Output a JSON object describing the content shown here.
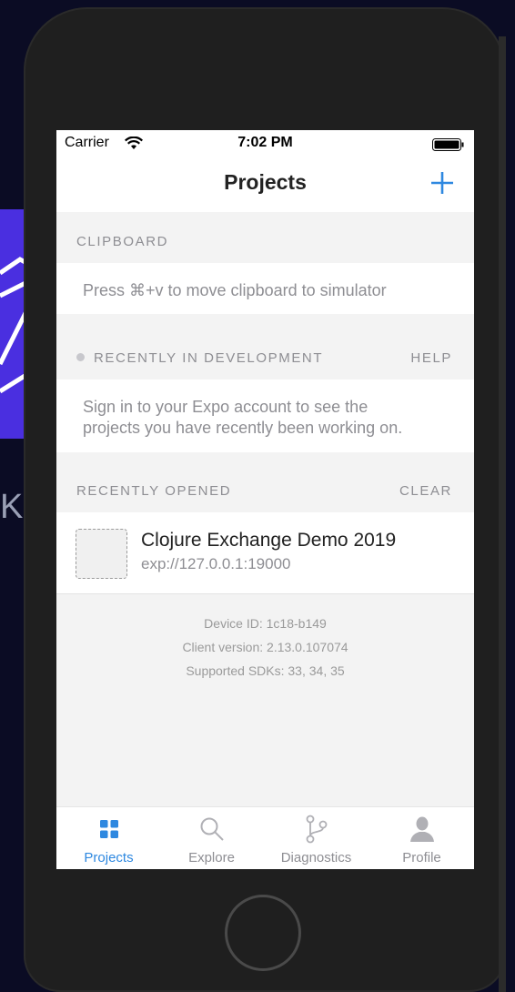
{
  "status_bar": {
    "carrier": "Carrier",
    "time": "7:02 PM"
  },
  "nav": {
    "title": "Projects"
  },
  "clipboard": {
    "header": "CLIPBOARD",
    "message": "Press ⌘+v to move clipboard to simulator"
  },
  "recent_dev": {
    "header": "RECENTLY IN DEVELOPMENT",
    "action": "HELP",
    "message_line1": "Sign in to your Expo account to see the",
    "message_line2": "projects you have recently been working on."
  },
  "recent_opened": {
    "header": "RECENTLY OPENED",
    "action": "CLEAR",
    "projects": [
      {
        "title": "Clojure Exchange Demo 2019",
        "url": "exp://127.0.0.1:19000"
      }
    ]
  },
  "device_info": {
    "device_id": "Device ID: 1c18-b149",
    "client_version": "Client version: 2.13.0.107074",
    "sdks": "Supported SDKs: 33, 34, 35"
  },
  "tabs": [
    {
      "label": "Projects",
      "icon": "grid-icon",
      "active": true
    },
    {
      "label": "Explore",
      "icon": "search-icon",
      "active": false
    },
    {
      "label": "Diagnostics",
      "icon": "branch-icon",
      "active": false
    },
    {
      "label": "Profile",
      "icon": "user-icon",
      "active": false
    }
  ],
  "background": {
    "letter": "K"
  },
  "colors": {
    "accent": "#2e88e0",
    "background": "#0b0c24",
    "slide": "#4a2fe0"
  }
}
